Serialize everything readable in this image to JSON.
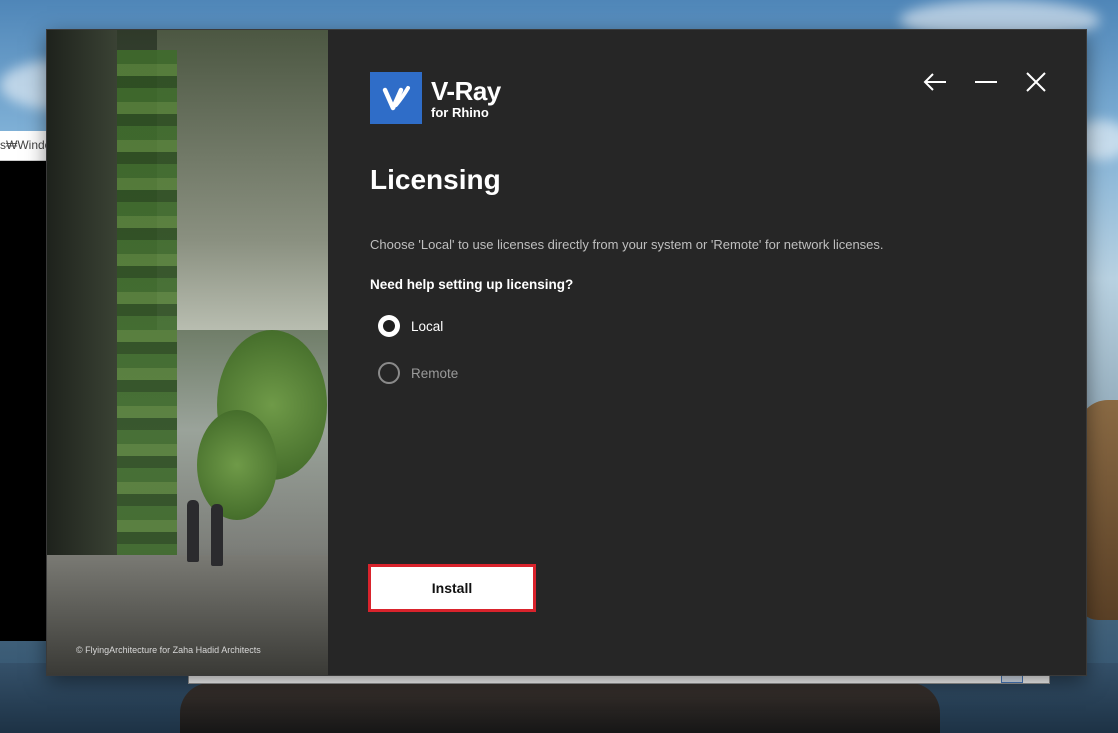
{
  "background_window": {
    "title_fragment": "s₩Windo"
  },
  "installer": {
    "brand": {
      "name": "V-Ray",
      "subtitle": "for Rhino",
      "accent": "#2f6dc8"
    },
    "photo_credit": "© FlyingArchitecture for Zaha Hadid Architects",
    "title": "Licensing",
    "description": "Choose 'Local' to use licenses directly from your system or 'Remote' for network licenses.",
    "help_text": "Need help setting up licensing?",
    "options": [
      {
        "label": "Local",
        "selected": true
      },
      {
        "label": "Remote",
        "selected": false
      }
    ],
    "install_button": "Install",
    "highlight_color": "#d9232c",
    "window_controls": [
      "back-arrow-icon",
      "minimize-icon",
      "close-icon"
    ]
  }
}
